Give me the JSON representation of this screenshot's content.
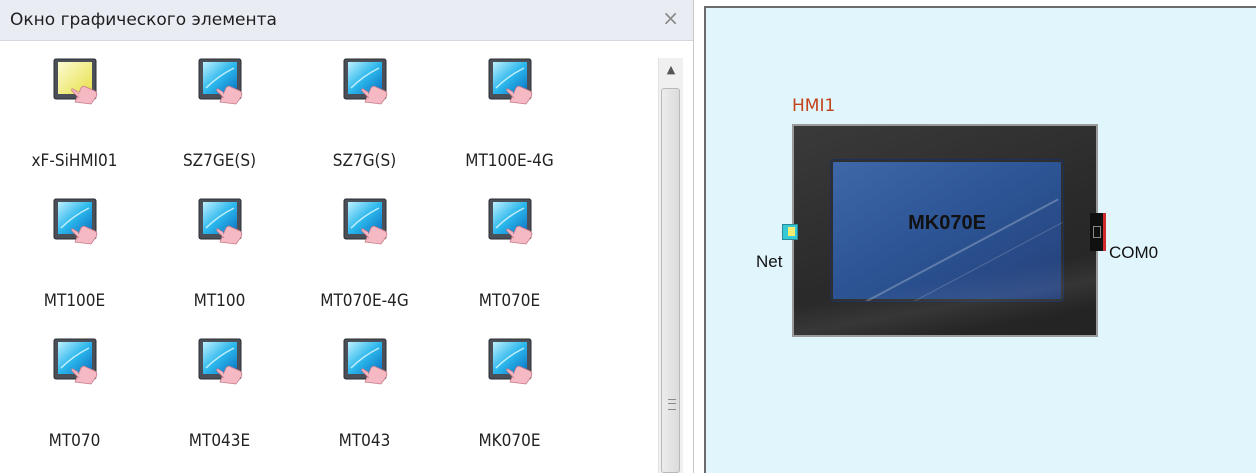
{
  "panel": {
    "title": "Окно графического элемента",
    "close_glyph": "×",
    "items": [
      {
        "label": "xF-SiHMI01",
        "icon": "hmi-yellow-screen-icon"
      },
      {
        "label": "SZ7GE(S)",
        "icon": "hmi-touch-screen-icon"
      },
      {
        "label": "SZ7G(S)",
        "icon": "hmi-touch-screen-icon"
      },
      {
        "label": "MT100E-4G",
        "icon": "hmi-touch-screen-icon"
      },
      {
        "label": "MT100E",
        "icon": "hmi-touch-screen-icon"
      },
      {
        "label": "MT100",
        "icon": "hmi-touch-screen-icon"
      },
      {
        "label": "MT070E-4G",
        "icon": "hmi-touch-screen-icon"
      },
      {
        "label": "MT070E",
        "icon": "hmi-touch-screen-icon"
      },
      {
        "label": "MT070",
        "icon": "hmi-touch-screen-icon"
      },
      {
        "label": "MT043E",
        "icon": "hmi-touch-screen-icon"
      },
      {
        "label": "MT043",
        "icon": "hmi-touch-screen-icon"
      },
      {
        "label": "MK070E",
        "icon": "hmi-touch-screen-icon"
      }
    ]
  },
  "scrollbar": {
    "up_glyph": "▲",
    "grip_icon": "scroll-grip-icon"
  },
  "canvas": {
    "device_name": "HMI1",
    "device_model": "MK070E",
    "port_left_label": "Net",
    "port_right_label": "COM0"
  },
  "colors": {
    "canvas_bg": "#e0f6fc",
    "device_name": "#c2421a",
    "screen_blue": "#2c5494",
    "com_port_accent": "#d22b2b",
    "net_port": "#36c8d4"
  }
}
